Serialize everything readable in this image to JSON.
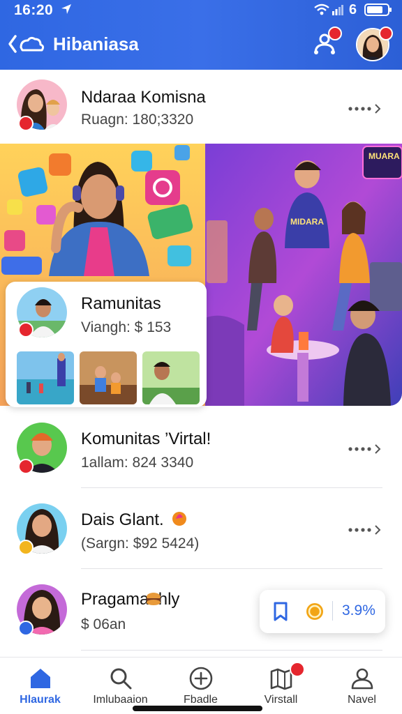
{
  "status_bar": {
    "time": "16:20",
    "carrier": "6"
  },
  "header": {
    "title": "Hibaniasa"
  },
  "list_top": {
    "title": "Ndaraa Komisna",
    "subtitle": "Ruagn: 180;3320"
  },
  "feature": {
    "title": "Ramunitas",
    "subtitle": "Viangh: $ 153"
  },
  "banner": {
    "sign_text": "MUARA",
    "shirt_text": "MIDARA"
  },
  "list": [
    {
      "title": "Komunitas ’Virtal!",
      "subtitle": "1allam: 824     3340"
    },
    {
      "title": "Dais Glant.",
      "subtitle": "(Sargn: $92 5424)"
    },
    {
      "title": "Pragama  hly",
      "subtitle": "$ 06an"
    }
  ],
  "action_card": {
    "percent": "3.9%"
  },
  "bottom_nav": [
    {
      "label": "Hlaurak",
      "icon": "home-icon",
      "active": true
    },
    {
      "label": "Imlubaaion",
      "icon": "search-icon",
      "active": false
    },
    {
      "label": "Fbadle",
      "icon": "add-circle-icon",
      "active": false
    },
    {
      "label": "Virstall",
      "icon": "map-icon",
      "active": false
    },
    {
      "label": "Navel",
      "icon": "profile-icon",
      "active": false
    }
  ],
  "colors": {
    "primary": "#2f67e2",
    "badge": "#e5262e",
    "coin": "#f2a516"
  }
}
